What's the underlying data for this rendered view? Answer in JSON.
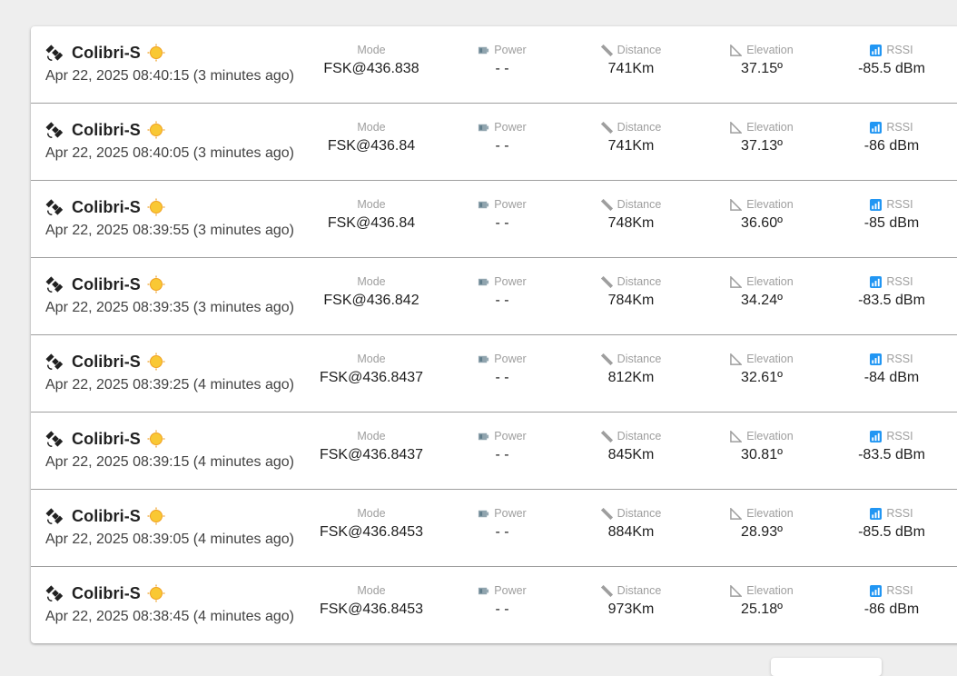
{
  "colors": {
    "background": "#eeeeee",
    "card": "#ffffff",
    "label": "#9e9e9e",
    "text": "#212121",
    "sun": "#f9c834",
    "rssi_icon": "#2196f3"
  },
  "labels": {
    "mode": "Mode",
    "power": "Power",
    "distance": "Distance",
    "elevation": "Elevation",
    "rssi": "RSSI"
  },
  "icons": {
    "satellite": "satellite-icon",
    "sun": "sun-icon",
    "power": "power-icon",
    "distance": "ruler-icon",
    "elevation": "angle-icon",
    "rssi": "signal-icon"
  },
  "packets": [
    {
      "name": "Colibri-S",
      "timestamp": "Apr 22, 2025 08:40:15 (3 minutes ago)",
      "mode": "FSK@436.838",
      "power": "- -",
      "distance": "741Km",
      "elevation": "37.15º",
      "rssi": "-85.5 dBm"
    },
    {
      "name": "Colibri-S",
      "timestamp": "Apr 22, 2025 08:40:05 (3 minutes ago)",
      "mode": "FSK@436.84",
      "power": "- -",
      "distance": "741Km",
      "elevation": "37.13º",
      "rssi": "-86 dBm"
    },
    {
      "name": "Colibri-S",
      "timestamp": "Apr 22, 2025 08:39:55 (3 minutes ago)",
      "mode": "FSK@436.84",
      "power": "- -",
      "distance": "748Km",
      "elevation": "36.60º",
      "rssi": "-85 dBm"
    },
    {
      "name": "Colibri-S",
      "timestamp": "Apr 22, 2025 08:39:35 (3 minutes ago)",
      "mode": "FSK@436.842",
      "power": "- -",
      "distance": "784Km",
      "elevation": "34.24º",
      "rssi": "-83.5 dBm"
    },
    {
      "name": "Colibri-S",
      "timestamp": "Apr 22, 2025 08:39:25 (4 minutes ago)",
      "mode": "FSK@436.8437",
      "power": "- -",
      "distance": "812Km",
      "elevation": "32.61º",
      "rssi": "-84 dBm"
    },
    {
      "name": "Colibri-S",
      "timestamp": "Apr 22, 2025 08:39:15 (4 minutes ago)",
      "mode": "FSK@436.8437",
      "power": "- -",
      "distance": "845Km",
      "elevation": "30.81º",
      "rssi": "-83.5 dBm"
    },
    {
      "name": "Colibri-S",
      "timestamp": "Apr 22, 2025 08:39:05 (4 minutes ago)",
      "mode": "FSK@436.8453",
      "power": "- -",
      "distance": "884Km",
      "elevation": "28.93º",
      "rssi": "-85.5 dBm"
    },
    {
      "name": "Colibri-S",
      "timestamp": "Apr 22, 2025 08:38:45 (4 minutes ago)",
      "mode": "FSK@436.8453",
      "power": "- -",
      "distance": "973Km",
      "elevation": "25.18º",
      "rssi": "-86 dBm"
    }
  ]
}
